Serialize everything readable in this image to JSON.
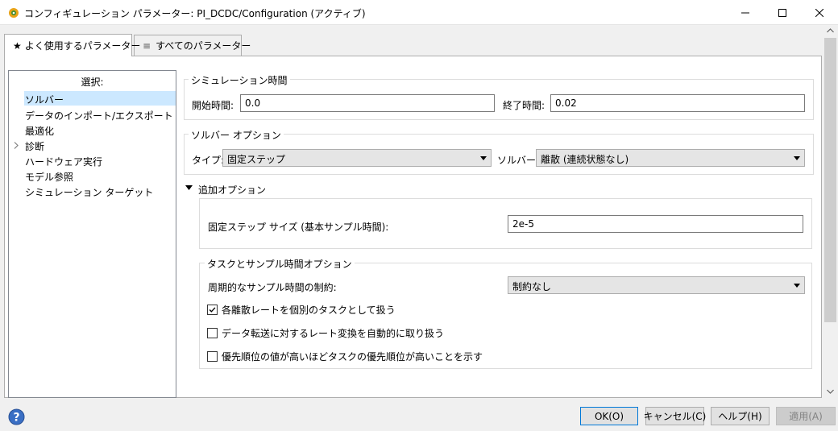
{
  "window": {
    "title": "コンフィギュレーション パラメーター: PI_DCDC/Configuration (アクティブ)"
  },
  "tabs": [
    {
      "label": "よく使用するパラメーター",
      "icon": "star-icon"
    },
    {
      "label": "すべてのパラメーター",
      "icon": "list-icon"
    }
  ],
  "tree": {
    "header": "選択:",
    "items": [
      {
        "label": "ソルバー"
      },
      {
        "label": "データのインポート/エクスポート"
      },
      {
        "label": "最適化"
      },
      {
        "label": "診断"
      },
      {
        "label": "ハードウェア実行"
      },
      {
        "label": "モデル参照"
      },
      {
        "label": "シミュレーション ターゲット"
      }
    ]
  },
  "sim_time": {
    "title": "シミュレーション時間",
    "start_label": "開始時間:",
    "start_value": "0.0",
    "stop_label": "終了時間:",
    "stop_value": "0.02"
  },
  "solver_opts": {
    "title": "ソルバー オプション",
    "type_label": "タイプ:",
    "type_value": "固定ステップ",
    "solver_label": "ソルバー:",
    "solver_value": "離散 (連続状態なし)"
  },
  "additional": {
    "title": "追加オプション",
    "fixed_step_label": "固定ステップ サイズ (基本サンプル時間):",
    "fixed_step_value": "2e-5",
    "tasks_title": "タスクとサンプル時間オプション",
    "periodic_label": "周期的なサンプル時間の制約:",
    "periodic_value": "制約なし",
    "checks": [
      {
        "label": "各離散レートを個別のタスクとして扱う",
        "checked": true
      },
      {
        "label": "データ転送に対するレート変換を自動的に取り扱う",
        "checked": false
      },
      {
        "label": "優先順位の値が高いほどタスクの優先順位が高いことを示す",
        "checked": false
      }
    ]
  },
  "buttons": {
    "ok": "OK(O)",
    "cancel": "キャンセル(C)",
    "help": "ヘルプ(H)",
    "apply": "適用(A)"
  }
}
